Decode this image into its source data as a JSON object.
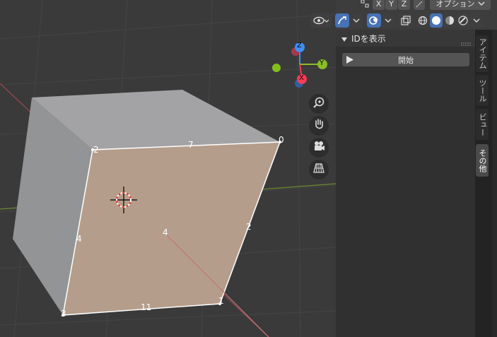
{
  "header": {
    "axis_toggles": [
      "X",
      "Y",
      "Z"
    ],
    "options_label": "オプション"
  },
  "gizmo": {
    "x_label": "X",
    "y_label": "Y",
    "z_label": "Z"
  },
  "viewport": {
    "vertex_labels": [
      "0",
      "1",
      "2",
      "3"
    ],
    "edge_labels": [
      "7",
      "2",
      "11",
      "4"
    ],
    "face_label": "4"
  },
  "npanel": {
    "section_title": "IDを表示",
    "start_button": "開始"
  },
  "tabs": [
    {
      "label": "アイテム",
      "active": false
    },
    {
      "label": "ツール",
      "active": false
    },
    {
      "label": "ビュー",
      "active": false
    },
    {
      "label": "その他",
      "active": true
    }
  ],
  "icons": {
    "visibility": "eye-icon",
    "gizmo_toggle": "gizmo-icon",
    "overlay_toggle": "overlay-icon",
    "xray": "xray-icon",
    "shading": [
      "wireframe-icon",
      "solid-icon",
      "material-icon",
      "rendered-icon"
    ],
    "nav": [
      "zoom-icon",
      "pan-hand-icon",
      "camera-icon",
      "grid-ortho-icon"
    ]
  },
  "colors": {
    "face_selected": "#b59d8b",
    "face_top": "#a3a3a5",
    "face_left": "#939495",
    "axis_x": "#f53d55",
    "axis_y": "#8bbd26",
    "axis_z": "#3d8ff7",
    "accent": "#4772b3"
  }
}
